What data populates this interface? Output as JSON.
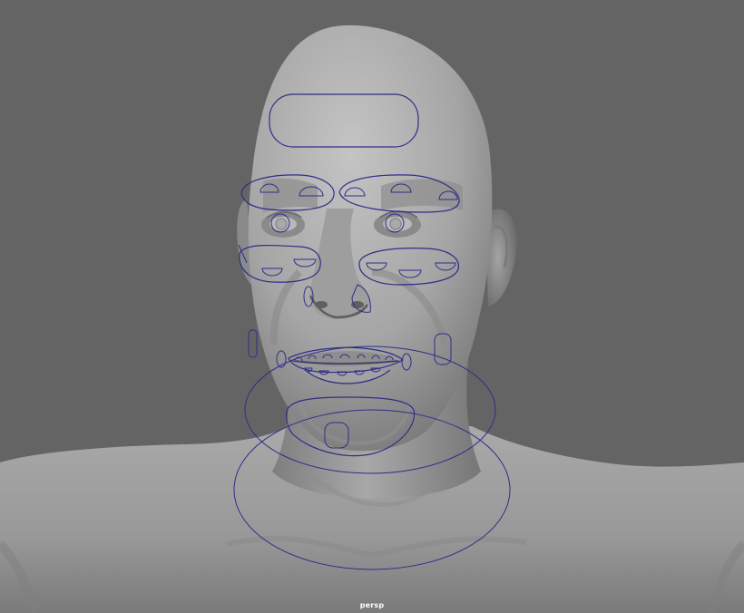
{
  "viewport": {
    "camera_label": "persp",
    "background_color": "#646464",
    "control_color": "#2d2f88"
  }
}
